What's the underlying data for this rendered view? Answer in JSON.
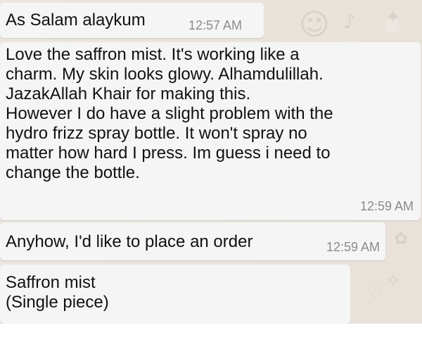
{
  "chat": {
    "messages": [
      {
        "text": "As Salam alaykum",
        "time": "12:57 AM"
      },
      {
        "lines": [
          "Love the saffron mist. It's working like a",
          "charm. My skin looks glowy. Alhamdulillah.",
          "JazakAllah Khair for making this.",
          "However I do have a slight problem with the",
          "hydro frizz spray bottle. It won't spray no",
          "matter how hard I press. Im guess i need to",
          "change the bottle."
        ],
        "time": "12:59 AM"
      },
      {
        "text": "Anyhow, I'd like to place an order",
        "time": "12:59 AM"
      },
      {
        "lines": [
          "Saffron mist",
          "(Single piece)"
        ]
      }
    ]
  },
  "colors": {
    "chat_background": "#e9e4dc",
    "message_bubble": "#f5f5f5",
    "timestamp": "#8b8b8b",
    "text": "#111111"
  }
}
